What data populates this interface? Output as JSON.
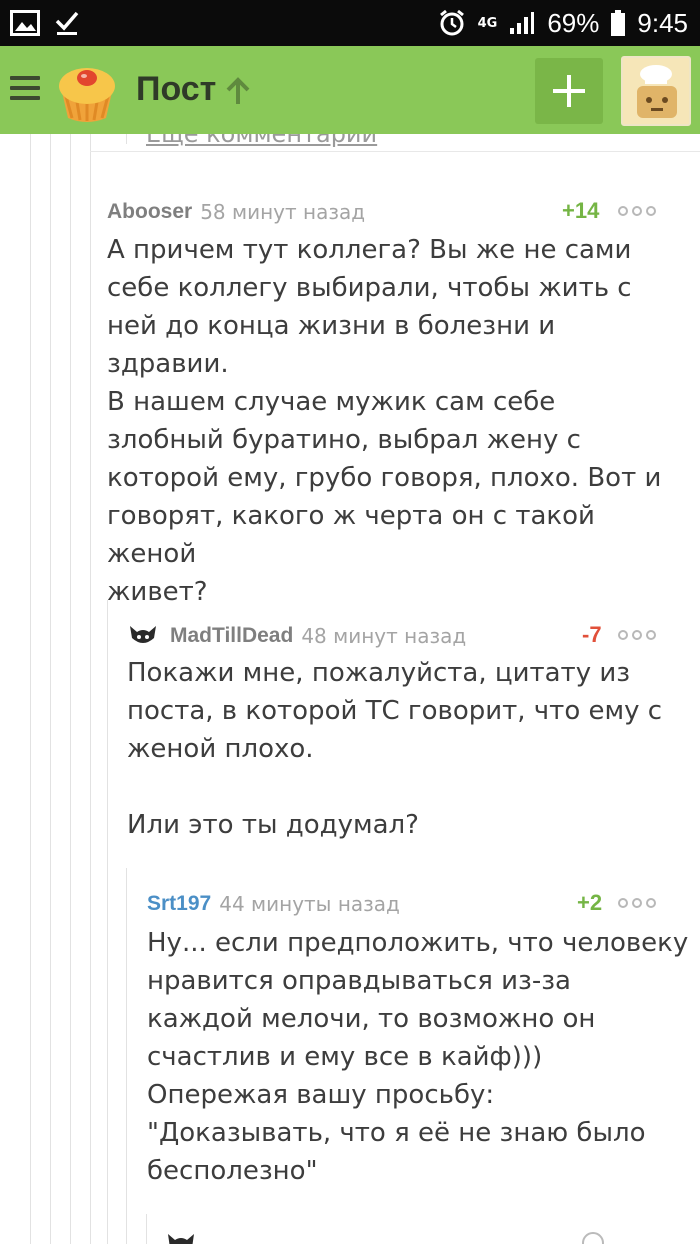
{
  "status_bar": {
    "network": "4G",
    "battery_percent": "69%",
    "time": "9:45"
  },
  "app_bar": {
    "title": "Пост"
  },
  "thread": {
    "more_comments_link": "Еще комментарии",
    "comments": [
      {
        "author": "Abooser",
        "time": "58 минут назад",
        "rating": "+14",
        "text": "А причем тут коллега? Вы же не сами\nсебе коллегу выбирали, чтобы жить с\nней до конца жизни в болезни и\nздравии.\nВ нашем случае мужик сам себе\nзлобный буратино, выбрал жену с\nкоторой ему, грубо говоря, плохо. Вот и\nговорят, какого ж черта он с такой женой\nживет?"
      },
      {
        "author": "MadTillDead",
        "time": "48 минут назад",
        "rating": "-7",
        "text": "Покажи мне, пожалуйста, цитату из\nпоста, в которой ТС говорит, что ему с\nженой плохо.\n\nИли это ты додумал?"
      },
      {
        "author": "Srt197",
        "time": "44 минуты назад",
        "rating": "+2",
        "text": "Ну... если предположить, что человеку\nнравится оправдываться из-за\nкаждой мелочи, то возможно он\nсчастлив и ему все в кайф)))\nОпережая вашу просьбу:\n\"Доказывать, что я её не знаю было\nбесполезно\""
      }
    ]
  },
  "colors": {
    "app_bar": "#8ac858",
    "positive_rating": "#75b545",
    "negative_rating": "#e1503a",
    "link_author": "#4b8fc6"
  }
}
